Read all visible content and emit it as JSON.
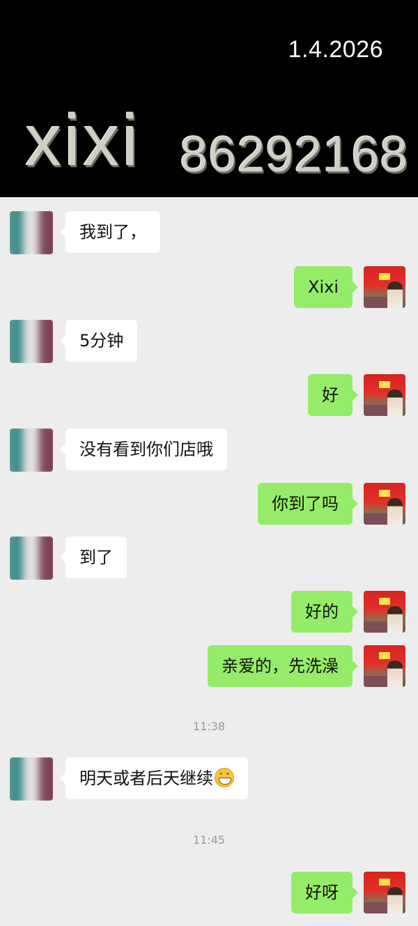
{
  "header": {
    "date": "1.4.2026",
    "name": "xixi",
    "number": "86292168"
  },
  "messages": [
    {
      "side": "left",
      "text": "我到了，"
    },
    {
      "side": "right",
      "text": "Xixi"
    },
    {
      "side": "left",
      "text": "5分钟"
    },
    {
      "side": "right",
      "text": "好"
    },
    {
      "side": "left",
      "text": "没有看到你们店哦"
    },
    {
      "side": "right",
      "text": "你到了吗"
    },
    {
      "side": "left",
      "text": "到了"
    },
    {
      "side": "right",
      "text": "好的"
    },
    {
      "side": "right",
      "text": "亲爱的，先洗澡"
    },
    {
      "side": "left",
      "text": "明天或者后天继续",
      "emoji": "grinning-face"
    },
    {
      "side": "right",
      "text": "好呀"
    }
  ],
  "timestamps": [
    "11:38",
    "11:45"
  ],
  "colors": {
    "outgoing_bubble": "#95ec69",
    "incoming_bubble": "#ffffff",
    "chat_background": "#ededed",
    "header_background": "#000000"
  }
}
